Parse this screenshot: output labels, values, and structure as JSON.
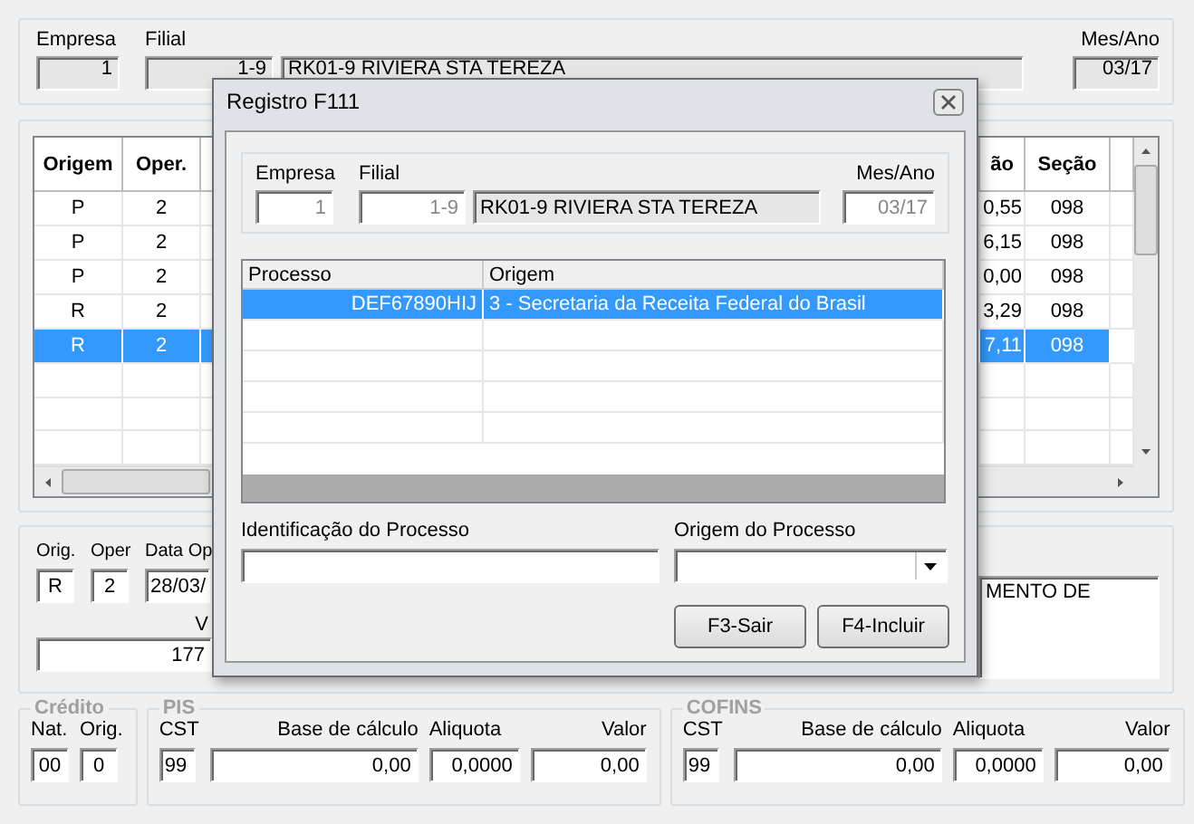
{
  "main_header": {
    "fields": [
      {
        "label": "Empresa",
        "value": "1"
      },
      {
        "label": "Filial",
        "value": "1-9",
        "name": "RK01-9 RIVIERA STA TEREZA"
      },
      {
        "label": "Mes/Ano",
        "value": "03/17"
      }
    ]
  },
  "grid": {
    "columns": [
      {
        "label": "Origem"
      },
      {
        "label": "Oper."
      },
      {
        "label": "ão"
      },
      {
        "label": "Seção"
      }
    ],
    "rows": [
      {
        "cells": [
          "P",
          "2",
          "0,55",
          "098"
        ],
        "selected": false
      },
      {
        "cells": [
          "P",
          "2",
          "6,15",
          "098"
        ],
        "selected": false
      },
      {
        "cells": [
          "P",
          "2",
          "0,00",
          "098"
        ],
        "selected": false
      },
      {
        "cells": [
          "R",
          "2",
          "3,29",
          "098"
        ],
        "selected": false
      },
      {
        "cells": [
          "R",
          "2",
          "7,11",
          "098"
        ],
        "selected": true
      }
    ]
  },
  "detail": {
    "orig_label": "Orig.",
    "orig": "R",
    "oper_label": "Oper",
    "oper": "2",
    "data_label": "Data Op",
    "data": "28/03/",
    "value_label": "V",
    "value": "177",
    "note": "MENTO DE"
  },
  "credito": {
    "title": "Crédito",
    "nat_label": "Nat.",
    "nat": "00",
    "orig_label": "Orig.",
    "orig": "0"
  },
  "pis": {
    "title": "PIS",
    "cst_label": "CST",
    "cst": "99",
    "base_label": "Base de cálculo",
    "base": "0,00",
    "aliquota_label": "Aliquota",
    "aliquota": "0,0000",
    "valor_label": "Valor",
    "valor": "0,00"
  },
  "cofins": {
    "title": "COFINS",
    "cst_label": "CST",
    "cst": "99",
    "base_label": "Base de cálculo",
    "base": "0,00",
    "aliquota_label": "Aliquota",
    "aliquota": "0,0000",
    "valor_label": "Valor",
    "valor": "0,00"
  },
  "dialog": {
    "title": "Registro F111",
    "header": {
      "fields": [
        {
          "label": "Empresa",
          "value": "1"
        },
        {
          "label": "Filial",
          "value": "1-9",
          "name": "RK01-9 RIVIERA STA TEREZA"
        },
        {
          "label": "Mes/Ano",
          "value": "03/17"
        }
      ]
    },
    "grid": {
      "columns": [
        {
          "label": "Processo"
        },
        {
          "label": "Origem"
        }
      ],
      "rows": [
        {
          "cells": [
            "DEF67890HIJ",
            "3 - Secretaria da Receita Federal do Brasil"
          ],
          "selected": true
        }
      ]
    },
    "identificacao": {
      "label": "Identificação do Processo"
    },
    "origem": {
      "label": "Origem do Processo"
    },
    "buttons": [
      "F3-Sair",
      "F4-Incluir"
    ]
  }
}
